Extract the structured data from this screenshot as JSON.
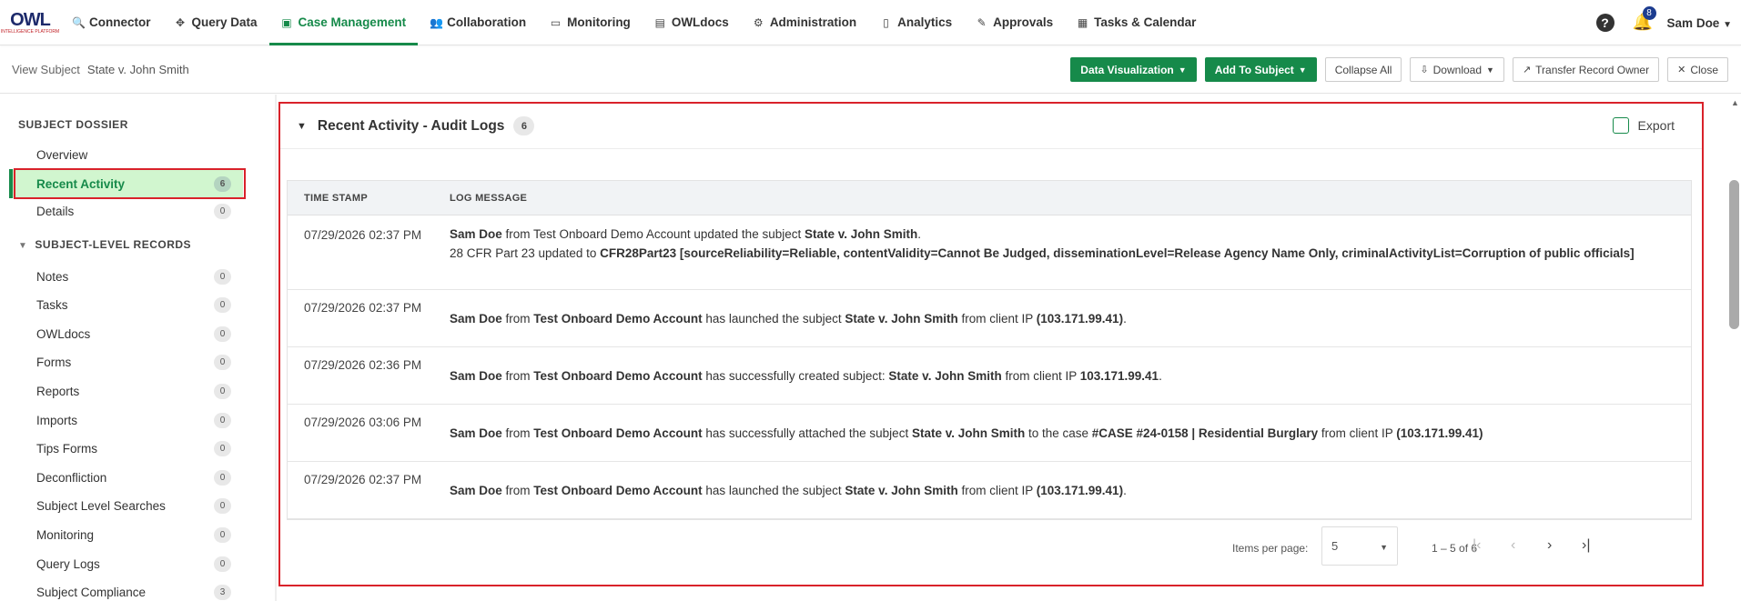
{
  "brand": {
    "name": "OWL",
    "sub": "INTELLIGENCE PLATFORM"
  },
  "nav": {
    "items": [
      {
        "label": "Connector",
        "icon": "search-icon"
      },
      {
        "label": "Query Data",
        "icon": "move-icon"
      },
      {
        "label": "Case Management",
        "icon": "document-icon"
      },
      {
        "label": "Collaboration",
        "icon": "people-icon"
      },
      {
        "label": "Monitoring",
        "icon": "monitor-icon"
      },
      {
        "label": "OWLdocs",
        "icon": "docs-icon"
      },
      {
        "label": "Administration",
        "icon": "admin-icon"
      },
      {
        "label": "Analytics",
        "icon": "file-icon"
      },
      {
        "label": "Approvals",
        "icon": "approvals-icon"
      },
      {
        "label": "Tasks & Calendar",
        "icon": "calendar-icon"
      }
    ],
    "active": "Case Management",
    "notifications_count": "8",
    "user_name": "Sam Doe",
    "accent": "#168a4a"
  },
  "subheader": {
    "crumb_label": "View Subject",
    "crumb_subject": "State v. John Smith",
    "buttons": {
      "data_viz": "Data Visualization",
      "add_to_subject": "Add To Subject",
      "collapse_all": "Collapse All",
      "download": "Download",
      "transfer": "Transfer Record Owner",
      "close": "Close"
    }
  },
  "sidebar": {
    "section1": "SUBJECT DOSSIER",
    "section2": "SUBJECT-LEVEL RECORDS",
    "top_items": [
      {
        "label": "Overview",
        "count": ""
      },
      {
        "label": "Recent Activity",
        "count": "6"
      },
      {
        "label": "Details",
        "count": "0"
      }
    ],
    "records": [
      {
        "label": "Notes",
        "count": "0"
      },
      {
        "label": "Tasks",
        "count": "0"
      },
      {
        "label": "OWLdocs",
        "count": "0"
      },
      {
        "label": "Forms",
        "count": "0"
      },
      {
        "label": "Reports",
        "count": "0"
      },
      {
        "label": "Imports",
        "count": "0"
      },
      {
        "label": "Tips Forms",
        "count": "0"
      },
      {
        "label": "Deconfliction",
        "count": "0"
      },
      {
        "label": "Subject Level Searches",
        "count": "0"
      },
      {
        "label": "Monitoring",
        "count": "0"
      },
      {
        "label": "Query Logs",
        "count": "0"
      },
      {
        "label": "Subject Compliance",
        "count": "3"
      }
    ]
  },
  "panel": {
    "title": "Recent Activity - Audit Logs",
    "count": "6",
    "export_label": "Export",
    "columns": {
      "timestamp": "TIME STAMP",
      "message": "LOG MESSAGE"
    },
    "rows": [
      {
        "ts": "07/29/2026 02:37 PM",
        "parts": [
          {
            "t": "Sam Doe",
            "b": true
          },
          {
            "t": " from Test Onboard Demo Account updated the subject ",
            "b": false
          },
          {
            "t": "State v. John Smith",
            "b": true
          },
          {
            "t": ".",
            "b": false
          },
          {
            "t": "\n",
            "b": false
          },
          {
            "t": "28 CFR Part 23 updated to ",
            "b": false
          },
          {
            "t": "CFR28Part23 [sourceReliability=Reliable, contentValidity=Cannot Be Judged, disseminationLevel=Release Agency Name Only, criminalActivityList=Corruption of public officials]",
            "b": true
          }
        ]
      },
      {
        "ts": "07/29/2026 02:37 PM",
        "parts": [
          {
            "t": "Sam Doe",
            "b": true
          },
          {
            "t": " from ",
            "b": false
          },
          {
            "t": "Test Onboard Demo Account",
            "b": true
          },
          {
            "t": " has launched the subject ",
            "b": false
          },
          {
            "t": "State v. John Smith",
            "b": true
          },
          {
            "t": " from client IP ",
            "b": false
          },
          {
            "t": "(103.171.99.41)",
            "b": true
          },
          {
            "t": ".",
            "b": false
          }
        ]
      },
      {
        "ts": "07/29/2026 02:36 PM",
        "parts": [
          {
            "t": "Sam Doe",
            "b": true
          },
          {
            "t": " from ",
            "b": false
          },
          {
            "t": "Test Onboard Demo Account",
            "b": true
          },
          {
            "t": " has successfully created subject: ",
            "b": false
          },
          {
            "t": "State v. John Smith",
            "b": true
          },
          {
            "t": " from client IP ",
            "b": false
          },
          {
            "t": "103.171.99.41",
            "b": true
          },
          {
            "t": ".",
            "b": false
          }
        ]
      },
      {
        "ts": "07/29/2026 03:06 PM",
        "parts": [
          {
            "t": "Sam Doe",
            "b": true
          },
          {
            "t": " from ",
            "b": false
          },
          {
            "t": "Test Onboard Demo Account",
            "b": true
          },
          {
            "t": " has successfully attached the subject ",
            "b": false
          },
          {
            "t": "State v. John Smith",
            "b": true
          },
          {
            "t": " to the case ",
            "b": false
          },
          {
            "t": "#CASE #24-0158 | Residential Burglary",
            "b": true
          },
          {
            "t": " from client IP ",
            "b": false
          },
          {
            "t": "(103.171.99.41)",
            "b": true
          }
        ]
      },
      {
        "ts": "07/29/2026 02:37 PM",
        "parts": [
          {
            "t": "Sam Doe",
            "b": true
          },
          {
            "t": " from ",
            "b": false
          },
          {
            "t": "Test Onboard Demo Account",
            "b": true
          },
          {
            "t": " has launched the subject ",
            "b": false
          },
          {
            "t": "State v. John Smith",
            "b": true
          },
          {
            "t": " from client IP ",
            "b": false
          },
          {
            "t": "(103.171.99.41)",
            "b": true
          },
          {
            "t": ".",
            "b": false
          }
        ]
      }
    ],
    "pagination": {
      "items_per_page_label": "Items per page:",
      "items_per_page": "5",
      "range": "1 – 5 of 6"
    }
  }
}
